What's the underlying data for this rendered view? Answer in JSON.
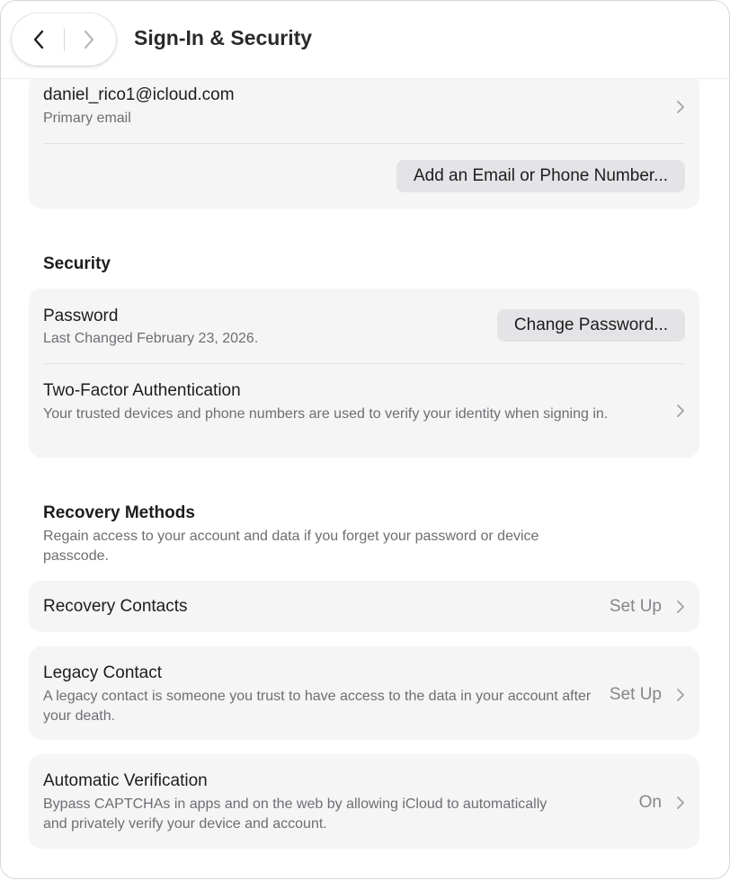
{
  "header": {
    "title": "Sign-In & Security"
  },
  "email_card": {
    "email": "daniel_rico1@icloud.com",
    "email_label": "Primary email",
    "add_button": "Add an Email or Phone Number..."
  },
  "security": {
    "heading": "Security",
    "password_title": "Password",
    "password_sub": "Last Changed February 23, 2026.",
    "change_button": "Change Password...",
    "tfa_title": "Two-Factor Authentication",
    "tfa_sub": "Your trusted devices and phone numbers are used to verify your identity when signing in."
  },
  "recovery": {
    "heading": "Recovery Methods",
    "description": "Regain access to your account and data if you forget your password or device passcode.",
    "contacts_title": "Recovery Contacts",
    "contacts_value": "Set Up",
    "legacy_title": "Legacy Contact",
    "legacy_sub": "A legacy contact is someone you trust to have access to the data in your account after your death.",
    "legacy_value": "Set Up",
    "auto_title": "Automatic Verification",
    "auto_sub": "Bypass CAPTCHAs in apps and on the web by allowing iCloud to automatically and privately verify your device and account.",
    "auto_value": "On"
  },
  "colors": {
    "card_bg": "#f5f5f6",
    "secondary_text": "#6e6e73",
    "button_bg": "#e4e4e6"
  },
  "icons": {
    "back": "chevron-left-icon",
    "forward": "chevron-right-icon",
    "disclosure": "chevron-right-icon"
  }
}
